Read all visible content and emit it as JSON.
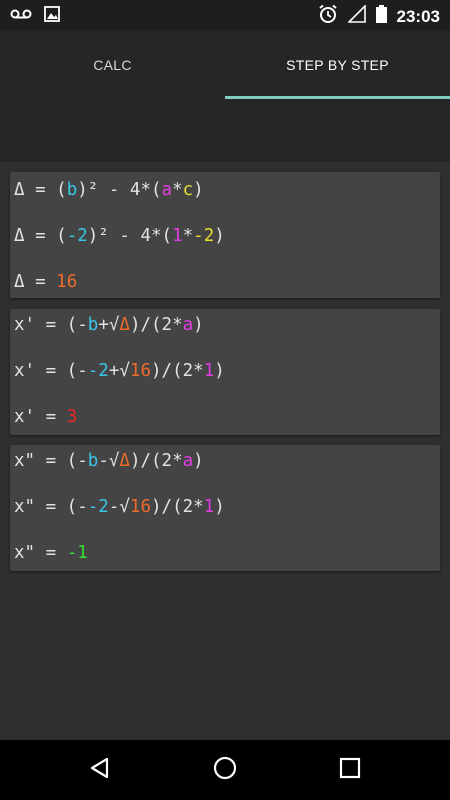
{
  "status_bar": {
    "time": "23:03",
    "icons": [
      "voicemail-icon",
      "image-icon",
      "alarm-icon",
      "signal-icon",
      "battery-icon"
    ]
  },
  "tabs": [
    {
      "label": "CALC",
      "selected": false
    },
    {
      "label": "STEP BY STEP",
      "selected": true
    }
  ],
  "colors": {
    "accent": "#7fcbc0",
    "b": "#36c8e8",
    "a": "#e23ee3",
    "c": "#e6dd2e",
    "delta": "#ec6b2c",
    "x1": "#ee2424",
    "x2": "#35de34"
  },
  "cards": [
    {
      "lines": [
        [
          [
            "Δ = (",
            ""
          ],
          [
            "b",
            "cyan"
          ],
          [
            ")² - 4*(",
            ""
          ],
          [
            "a",
            "magenta"
          ],
          [
            "*",
            ""
          ],
          [
            "c",
            "yellow"
          ],
          [
            ")",
            ""
          ]
        ],
        [
          [
            "Δ = (",
            ""
          ],
          [
            "-2",
            "cyan"
          ],
          [
            ")² - 4*(",
            ""
          ],
          [
            "1",
            "magenta"
          ],
          [
            "*",
            ""
          ],
          [
            "-2",
            "yellow"
          ],
          [
            ")",
            ""
          ]
        ],
        [
          [
            "Δ = ",
            ""
          ],
          [
            "16",
            "orange"
          ]
        ]
      ]
    },
    {
      "lines": [
        [
          [
            "x' = (-",
            ""
          ],
          [
            "b",
            "cyan"
          ],
          [
            "+√",
            ""
          ],
          [
            "Δ",
            "orange"
          ],
          [
            ")/(2*",
            ""
          ],
          [
            "a",
            "magenta"
          ],
          [
            ")",
            ""
          ]
        ],
        [
          [
            "x' = (-",
            ""
          ],
          [
            "-2",
            "cyan"
          ],
          [
            "+√",
            ""
          ],
          [
            "16",
            "orange"
          ],
          [
            ")/(2*",
            ""
          ],
          [
            "1",
            "magenta"
          ],
          [
            ")",
            ""
          ]
        ],
        [
          [
            "x' = ",
            ""
          ],
          [
            "3",
            "red"
          ]
        ]
      ]
    },
    {
      "lines": [
        [
          [
            "x\" = (-",
            ""
          ],
          [
            "b",
            "cyan"
          ],
          [
            "-√",
            ""
          ],
          [
            "Δ",
            "orange"
          ],
          [
            ")/(2*",
            ""
          ],
          [
            "a",
            "magenta"
          ],
          [
            ")",
            ""
          ]
        ],
        [
          [
            "x\" = (-",
            ""
          ],
          [
            "-2",
            "cyan"
          ],
          [
            "-√",
            ""
          ],
          [
            "16",
            "orange"
          ],
          [
            ")/(2*",
            ""
          ],
          [
            "1",
            "magenta"
          ],
          [
            ")",
            ""
          ]
        ],
        [
          [
            "x\" = ",
            ""
          ],
          [
            "-1",
            "green"
          ]
        ]
      ]
    }
  ],
  "nav": {
    "back": "back-icon",
    "home": "home-icon",
    "recents": "recents-icon"
  }
}
